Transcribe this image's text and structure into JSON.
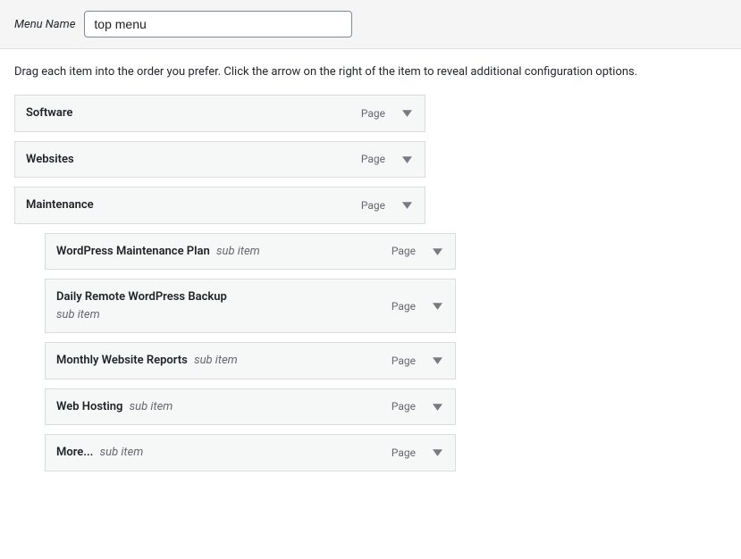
{
  "header": {
    "menu_name_label": "Menu Name",
    "menu_name_value": "top menu"
  },
  "instructions": "Drag each item into the order you prefer. Click the arrow on the right of the item to reveal additional configuration options.",
  "type_label": "Page",
  "sub_item_label": "sub item",
  "items": [
    {
      "title": "Software",
      "sub": false
    },
    {
      "title": "Websites",
      "sub": false
    },
    {
      "title": "Maintenance",
      "sub": false
    },
    {
      "title": "WordPress Maintenance Plan",
      "sub": true
    },
    {
      "title": "Daily Remote WordPress Backup",
      "sub": true
    },
    {
      "title": "Monthly Website Reports",
      "sub": true
    },
    {
      "title": "Web Hosting",
      "sub": true
    },
    {
      "title": "More...",
      "sub": true
    }
  ]
}
